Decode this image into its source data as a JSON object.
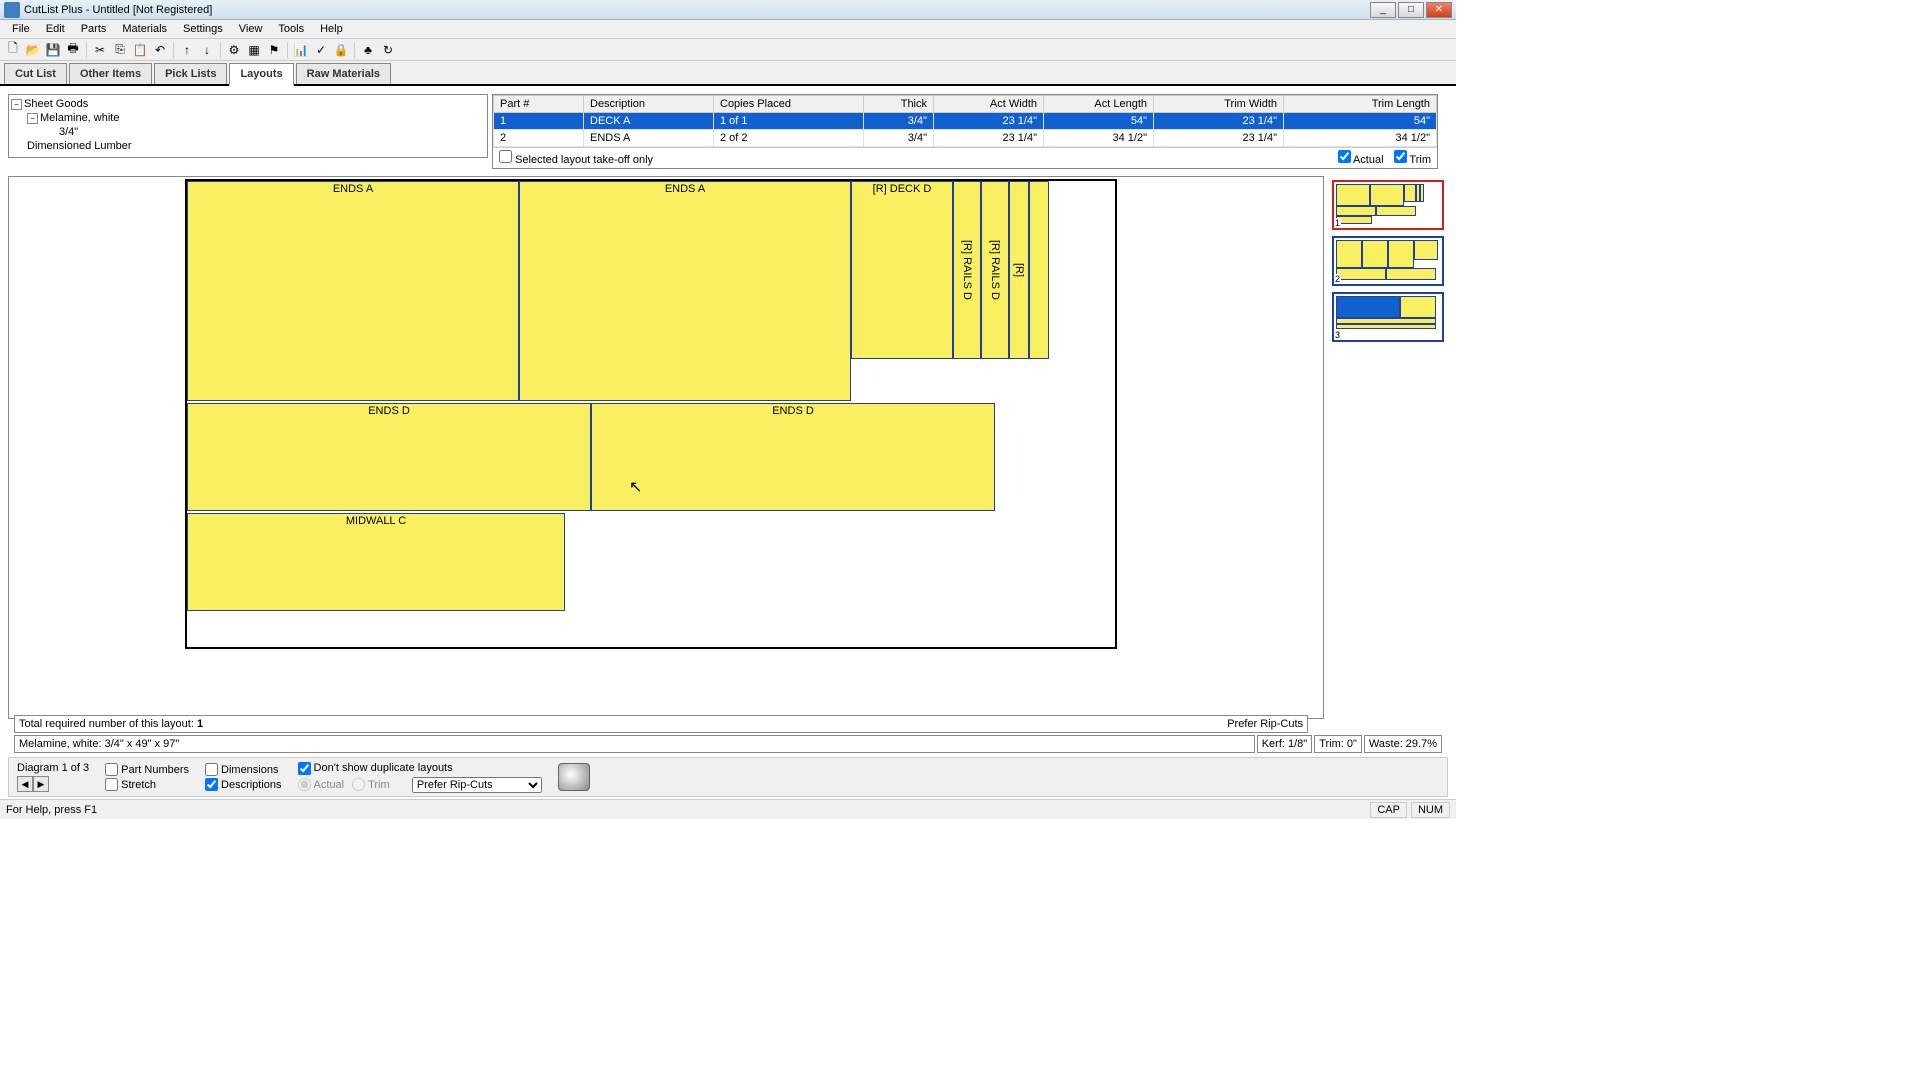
{
  "window": {
    "title": "CutList Plus - Untitled [Not Registered]"
  },
  "menu": [
    "File",
    "Edit",
    "Parts",
    "Materials",
    "Settings",
    "View",
    "Tools",
    "Help"
  ],
  "tabs": [
    "Cut List",
    "Other Items",
    "Pick Lists",
    "Layouts",
    "Raw Materials"
  ],
  "active_tab": "Layouts",
  "tree": {
    "root": "Sheet Goods",
    "child1": "Melamine, white",
    "child2": "3/4\"",
    "root2": "Dimensioned Lumber"
  },
  "table": {
    "headers": [
      "Part #",
      "Description",
      "Copies Placed",
      "Thick",
      "Act Width",
      "Act Length",
      "Trim Width",
      "Trim Length"
    ],
    "rows": [
      {
        "num": "1",
        "desc": "DECK A",
        "copies": "1 of 1",
        "thick": "3/4\"",
        "width": "23 1/4\"",
        "length": "54\"",
        "twidth": "23 1/4\"",
        "tlength": "54\"",
        "selected": true
      },
      {
        "num": "2",
        "desc": "ENDS A",
        "copies": "2 of 2",
        "thick": "3/4\"",
        "width": "23 1/4\"",
        "length": "34 1/2\"",
        "twidth": "23 1/4\"",
        "tlength": "34 1/2\"",
        "selected": false
      }
    ],
    "selected_takeoff": "Selected layout take-off only",
    "actual": "Actual",
    "trim": "Trim"
  },
  "layout_parts": {
    "ends_a": "ENDS A",
    "deck_d": "[R] DECK D",
    "rails_d": "[R] RAILS D",
    "r": "[R]",
    "ends_d": "ENDS D",
    "midwall_c": "MIDWALL C"
  },
  "info": {
    "total_required": "Total required number of this layout:",
    "total_required_val": "1",
    "prefer_rip": "Prefer Rip-Cuts",
    "material": "Melamine, white: 3/4\" x 49\" x 97\"",
    "kerf": "Kerf: 1/8\"",
    "trim": "Trim: 0\"",
    "waste": "Waste: 29.7%"
  },
  "bottom": {
    "diagram": "Diagram 1 of 3",
    "stretch": "Stretch",
    "part_numbers": "Part Numbers",
    "descriptions": "Descriptions",
    "dimensions": "Dimensions",
    "actual": "Actual",
    "trim": "Trim",
    "dont_dup": "Don't show duplicate layouts",
    "prefer_rip": "Prefer Rip-Cuts"
  },
  "status": {
    "help": "For Help, press F1",
    "cap": "CAP",
    "num": "NUM"
  }
}
